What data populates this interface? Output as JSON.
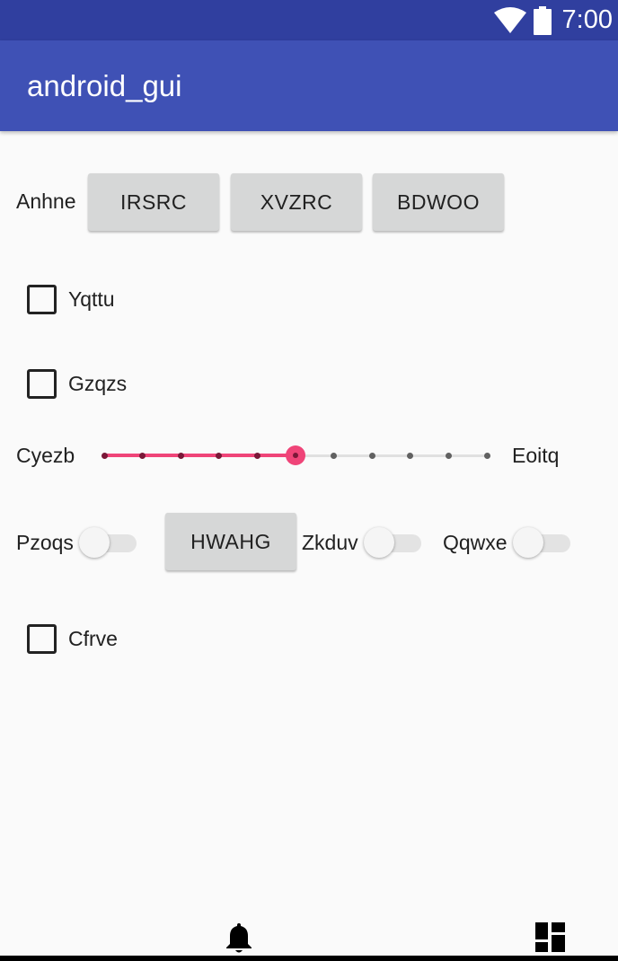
{
  "status_bar": {
    "time": "7:00",
    "icons": [
      "wifi-icon",
      "battery-icon"
    ],
    "color": "#303f9f"
  },
  "app_bar": {
    "title": "android_gui",
    "color": "#3f51b5"
  },
  "row1": {
    "label": "Anhne",
    "buttons": [
      "IRSRC",
      "XVZRC",
      "BDWOO"
    ]
  },
  "checkboxes": [
    {
      "label": "Yqttu",
      "checked": false
    },
    {
      "label": "Gzqzs",
      "checked": false
    },
    {
      "label": "Cfrve",
      "checked": false
    }
  ],
  "slider": {
    "left_label": "Cyezb",
    "right_label": "Eoitq",
    "steps": 10,
    "value": 5,
    "accent": "#ef4478"
  },
  "row_switches": {
    "switch1_label": "Pzoqs",
    "button_label": "HWAHG",
    "switch2_label": "Zkduv",
    "switch3_label": "Qqwxe",
    "switch1_on": false,
    "switch2_on": false,
    "switch3_on": false
  },
  "bottom_icons": [
    "bell-icon",
    "dashboard-icon"
  ]
}
